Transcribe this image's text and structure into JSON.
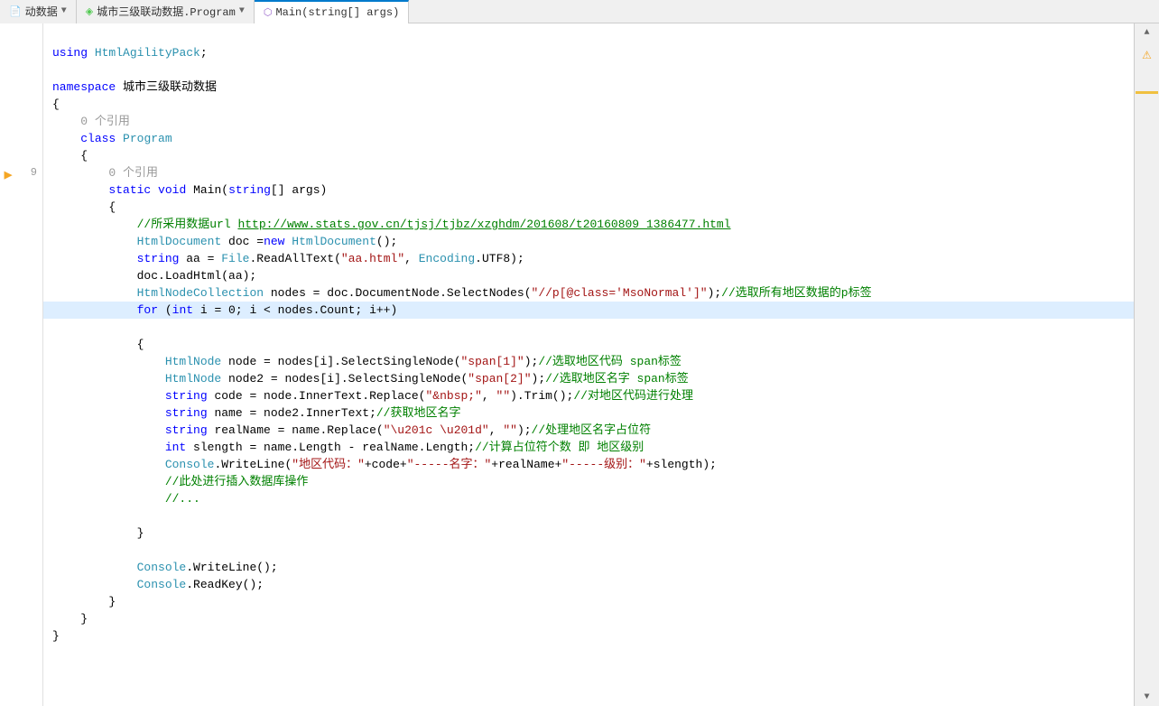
{
  "tabs": [
    {
      "id": "tab1",
      "label": "动数据",
      "active": false,
      "hasDropdown": true,
      "icon": "file-icon"
    },
    {
      "id": "tab2",
      "label": "城市三级联动数据.Program",
      "active": false,
      "hasDropdown": true,
      "icon": "class-icon"
    },
    {
      "id": "tab3",
      "label": "Main(string[] args)",
      "active": true,
      "hasDropdown": false,
      "icon": "method-icon"
    }
  ],
  "code": {
    "lines": [
      {
        "num": "",
        "text": "using HtmlAgilityPack;",
        "type": "using"
      },
      {
        "num": "",
        "text": ""
      },
      {
        "num": "",
        "text": "namespace 城市三级联动数据"
      },
      {
        "num": "",
        "text": "{"
      },
      {
        "num": "",
        "text": "    0 个引用"
      },
      {
        "num": "",
        "text": "    class Program"
      },
      {
        "num": "",
        "text": "    {"
      },
      {
        "num": "",
        "text": "        0 个引用"
      },
      {
        "num": "9",
        "text": "        static void Main(string[] args)"
      },
      {
        "num": "",
        "text": "        {"
      },
      {
        "num": "",
        "text": "            //所采用数据url http://www.stats.gov.cn/tjsj/tjbz/xzghdm/201608/t20160809_1386477.html"
      },
      {
        "num": "",
        "text": "            HtmlDocument doc =new HtmlDocument();"
      },
      {
        "num": "",
        "text": "            string aa = File.ReadAllText(\"aa.html\", Encoding.UTF8);"
      },
      {
        "num": "",
        "text": "            doc.LoadHtml(aa);"
      },
      {
        "num": "",
        "text": "            HtmlNodeCollection nodes = doc.DocumentNode.SelectNodes(\"//p[@class='MsoNormal']\");//选取所有地区数据的p标签"
      },
      {
        "num": "",
        "text": "            for (int i = 0; i < nodes.Count; i++)",
        "highlight": true
      },
      {
        "num": "",
        "text": "            {"
      },
      {
        "num": "",
        "text": "                HtmlNode node = nodes[i].SelectSingleNode(\"span[1]\");//选取地区代码 span标签"
      },
      {
        "num": "",
        "text": "                HtmlNode node2 = nodes[i].SelectSingleNode(\"span[2]\");//选取地区名字 span标签"
      },
      {
        "num": "",
        "text": "                string code = node.InnerText.Replace(\"&nbsp;\", \"\").Trim();//对地区代码进行处理"
      },
      {
        "num": "",
        "text": "                string name = node2.InnerText;//获取地区名字"
      },
      {
        "num": "",
        "text": "                string realName = name.Replace(\"“ ”\", \"\");//处理地区名字占位符"
      },
      {
        "num": "",
        "text": "                int slength = name.Length - realName.Length;//计算占位符个数 即 地区级别"
      },
      {
        "num": "",
        "text": "                Console.WriteLine(\"地区代码：\"+code+\"-----名字：\"+realName+\"-----级别：\"+slength);"
      },
      {
        "num": "",
        "text": "                //此处进行插入数据库操作"
      },
      {
        "num": "",
        "text": "                //..."
      },
      {
        "num": "",
        "text": ""
      },
      {
        "num": "",
        "text": "            }"
      },
      {
        "num": "",
        "text": ""
      },
      {
        "num": "",
        "text": "            Console.WriteLine();"
      },
      {
        "num": "",
        "text": "            Console.ReadKey();"
      },
      {
        "num": "",
        "text": "        }"
      },
      {
        "num": "",
        "text": "    }"
      },
      {
        "num": "",
        "text": "}"
      }
    ]
  },
  "indicators": {
    "warning_label": "⚠",
    "up_arrow": "▲",
    "down_arrow": "▼"
  }
}
